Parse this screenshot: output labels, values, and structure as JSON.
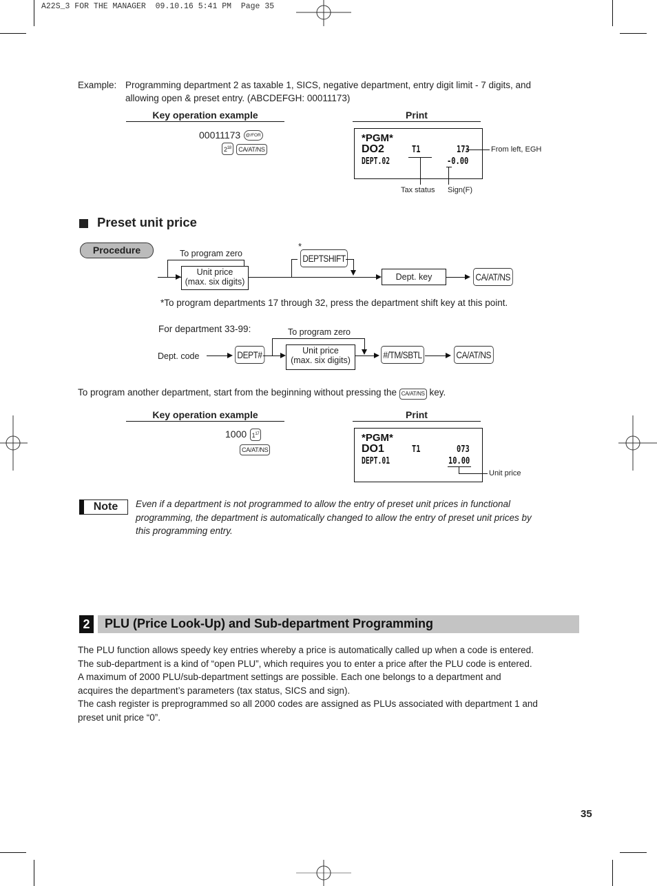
{
  "print_header": "A22S_3 FOR THE MANAGER  09.10.16 5:41 PM  Page 35",
  "example1": {
    "label": "Example:",
    "line1": "Programming department 2 as taxable 1, SICS, negative department, entry digit limit - 7 digits, and",
    "line2": "allowing open & preset entry.  (ABCDEFGH: 00011173)",
    "key_op_heading": "Key operation example",
    "print_heading": "Print",
    "key_entry": "00011173",
    "key_for": "@/FOR",
    "key_dept_main": "2",
    "key_dept_sup": "18",
    "key_caatns": "CA/AT/NS",
    "receipt": {
      "line1": "*PGM*",
      "line2_left": "DO2",
      "line2_mid": "T1",
      "line2_right": "173",
      "line3_left": "DEPT.02",
      "line3_right": "-0.00"
    },
    "callout_egh": "From left, EGH",
    "callout_tax": "Tax status",
    "callout_sign": "Sign(F)"
  },
  "preset_section": {
    "title": "Preset unit price",
    "procedure_badge": "Procedure",
    "to_program_zero": "To program zero",
    "unit_price_line1": "Unit price",
    "unit_price_line2": "(max. six digits)",
    "asterisk": "*",
    "deptshift_key": "DEPTSHIFT",
    "dept_key_box": "Dept. key",
    "caatns_key": "CA/AT/NS",
    "footnote": "*To program departments 17 through 32, press the department shift key at this point.",
    "dept33_label": "For department 33-99:",
    "dept_code_label": "Dept. code",
    "dept_hash_key": "DEPT#",
    "tm_sbtl_key": "#/TM/SBTL",
    "another_dept_pre": "To program another department, start from the beginning without pressing the",
    "another_dept_key": "CA/AT/NS",
    "another_dept_post": "key."
  },
  "example2": {
    "key_op_heading": "Key operation example",
    "print_heading": "Print",
    "key_entry": "1000",
    "key_dept_main": "1",
    "key_dept_sup": "17",
    "key_caatns": "CA/AT/NS",
    "receipt": {
      "line1": "*PGM*",
      "line2_left": "DO1",
      "line2_mid": "T1",
      "line2_right": "073",
      "line3_left": "DEPT.01",
      "line3_right": "10.00"
    },
    "callout_unit": "Unit price"
  },
  "note": {
    "badge": "Note",
    "text_line1": "Even if a department is not programmed to allow the entry of preset unit prices in functional",
    "text_line2": "programming, the department is automatically changed to allow the entry of preset unit prices by",
    "text_line3": "this programming entry."
  },
  "plu_section": {
    "number": "2",
    "title": "PLU (Price Look-Up) and Sub-department Programming",
    "paragraph": [
      "The PLU function allows speedy key entries whereby a price is automatically called up when a code is entered.",
      "The sub-department is a kind of “open PLU”, which requires you to enter a price after the PLU code is entered.",
      "A maximum of 2000 PLU/sub-department settings are possible.  Each one belongs to a department and",
      "acquires the department’s parameters (tax status, SICS and sign).",
      "The cash register is preprogrammed so all 2000 codes are assigned as PLUs associated with department 1 and",
      "preset unit price “0”."
    ]
  },
  "page_number": "35"
}
